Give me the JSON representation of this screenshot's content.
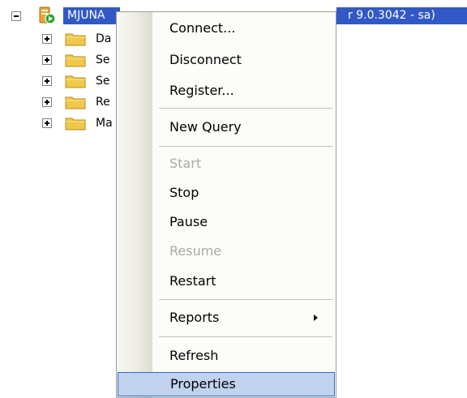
{
  "tree": {
    "root": {
      "label_visible": "MJUNA",
      "label_tail": "r 9.0.3042 - sa)"
    },
    "children": [
      {
        "label": "Da"
      },
      {
        "label": "Se"
      },
      {
        "label": "Se"
      },
      {
        "label": "Re"
      },
      {
        "label": "Ma"
      }
    ]
  },
  "menu": {
    "items": [
      {
        "label": "Connect...",
        "enabled": true
      },
      {
        "label": "Disconnect",
        "enabled": true
      },
      {
        "label": "Register...",
        "enabled": true
      },
      {
        "label": "New Query",
        "enabled": true
      },
      {
        "label": "Start",
        "enabled": false
      },
      {
        "label": "Stop",
        "enabled": true
      },
      {
        "label": "Pause",
        "enabled": true
      },
      {
        "label": "Resume",
        "enabled": false
      },
      {
        "label": "Restart",
        "enabled": true
      },
      {
        "label": "Reports",
        "enabled": true,
        "submenu": true
      },
      {
        "label": "Refresh",
        "enabled": true
      },
      {
        "label": "Properties",
        "enabled": true,
        "highlighted": true
      }
    ]
  },
  "colors": {
    "selection": "#3158c5",
    "menu_hover": "#c1d2ee",
    "disabled_text": "#a9a9a9"
  }
}
